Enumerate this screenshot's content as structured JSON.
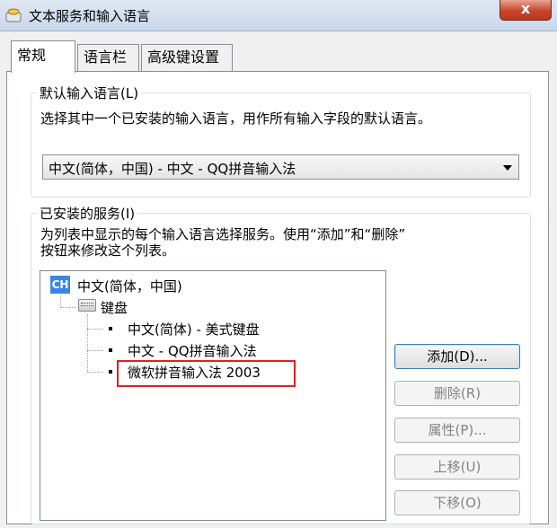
{
  "window": {
    "title": "文本服务和输入语言",
    "close_label": "x"
  },
  "tabs": [
    {
      "label": "常规",
      "active": true
    },
    {
      "label": "语言栏",
      "active": false
    },
    {
      "label": "高级键设置",
      "active": false
    }
  ],
  "default_language": {
    "legend": "默认输入语言(L)",
    "description": "选择其中一个已安装的输入语言，用作所有输入字段的默认语言。",
    "selected": "中文(简体，中国) - 中文 - QQ拼音输入法"
  },
  "installed_services": {
    "legend": "已安装的服务(I)",
    "description_line1": "为列表中显示的每个输入语言选择服务。使用“添加”和“删除”",
    "description_line2": "按钮来修改这个列表。",
    "tree": {
      "language_badge": "CH",
      "language": "中文(简体，中国)",
      "category": "键盘",
      "items": [
        "中文(简体) - 美式键盘",
        "中文 - QQ拼音输入法",
        "微软拼音输入法 2003"
      ]
    },
    "buttons": {
      "add": "添加(D)...",
      "remove": "删除(R)",
      "properties": "属性(P)...",
      "move_up": "上移(U)",
      "move_down": "下移(O)"
    }
  },
  "colors": {
    "highlight_box": "#e02020",
    "ch_badge": "#3a86e0"
  }
}
